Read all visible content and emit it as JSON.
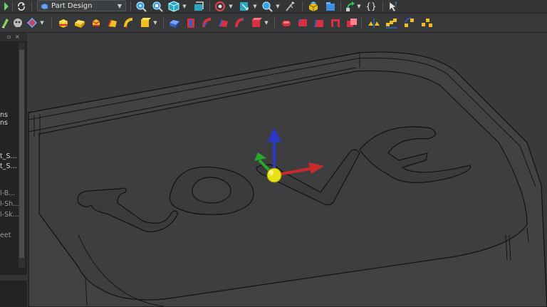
{
  "toolbar_top": {
    "workbench_selector": {
      "label": "Part Design",
      "icon": "part-design-icon"
    },
    "icons": [
      "refresh-icon",
      "zoom-fit-all-icon",
      "zoom-fit-selection-icon",
      "view-cube-icon",
      "draw-style-icon",
      "stereo-icon",
      "section-view-icon",
      "zoom-dropdown-icon",
      "measure-icon",
      "part-icon",
      "group-icon",
      "link-icon",
      "macro-icon",
      "whats-this-icon"
    ],
    "braces": "{}"
  },
  "toolbar_partdesign": {
    "icons": [
      "sketch-icon",
      "body-icon",
      "shape-binder-icon",
      "datum-plane-icon",
      "additive-box-icon",
      "pad-icon",
      "revolution-icon",
      "loft-icon",
      "pipe-icon",
      "additive-primitive-icon",
      "pocket-icon",
      "hole-icon",
      "groove-icon",
      "subtractive-loft-icon",
      "subtractive-pipe-icon",
      "subtractive-primitive-icon",
      "fillet-icon",
      "chamfer-icon",
      "draft-icon",
      "thickness-icon",
      "boolean-icon",
      "mirrored-icon",
      "linear-pattern-icon",
      "polar-pattern-icon",
      "multi-transform-icon"
    ]
  },
  "tree_panel": {
    "items": [
      "ns",
      "ns",
      "t_S...",
      "t_S...",
      "l-B...",
      "l-Sh...",
      "l-Sk..."
    ],
    "footer": "eet"
  },
  "viewport": {
    "engraved_text": "LOVE",
    "colors": {
      "background": "#3a3a3c",
      "model": "#404042",
      "outline": "#141414",
      "axis_x": "#cc2a2a",
      "axis_y": "#2aa62a",
      "axis_z": "#2a38c8",
      "origin": "#e8e21a"
    }
  }
}
